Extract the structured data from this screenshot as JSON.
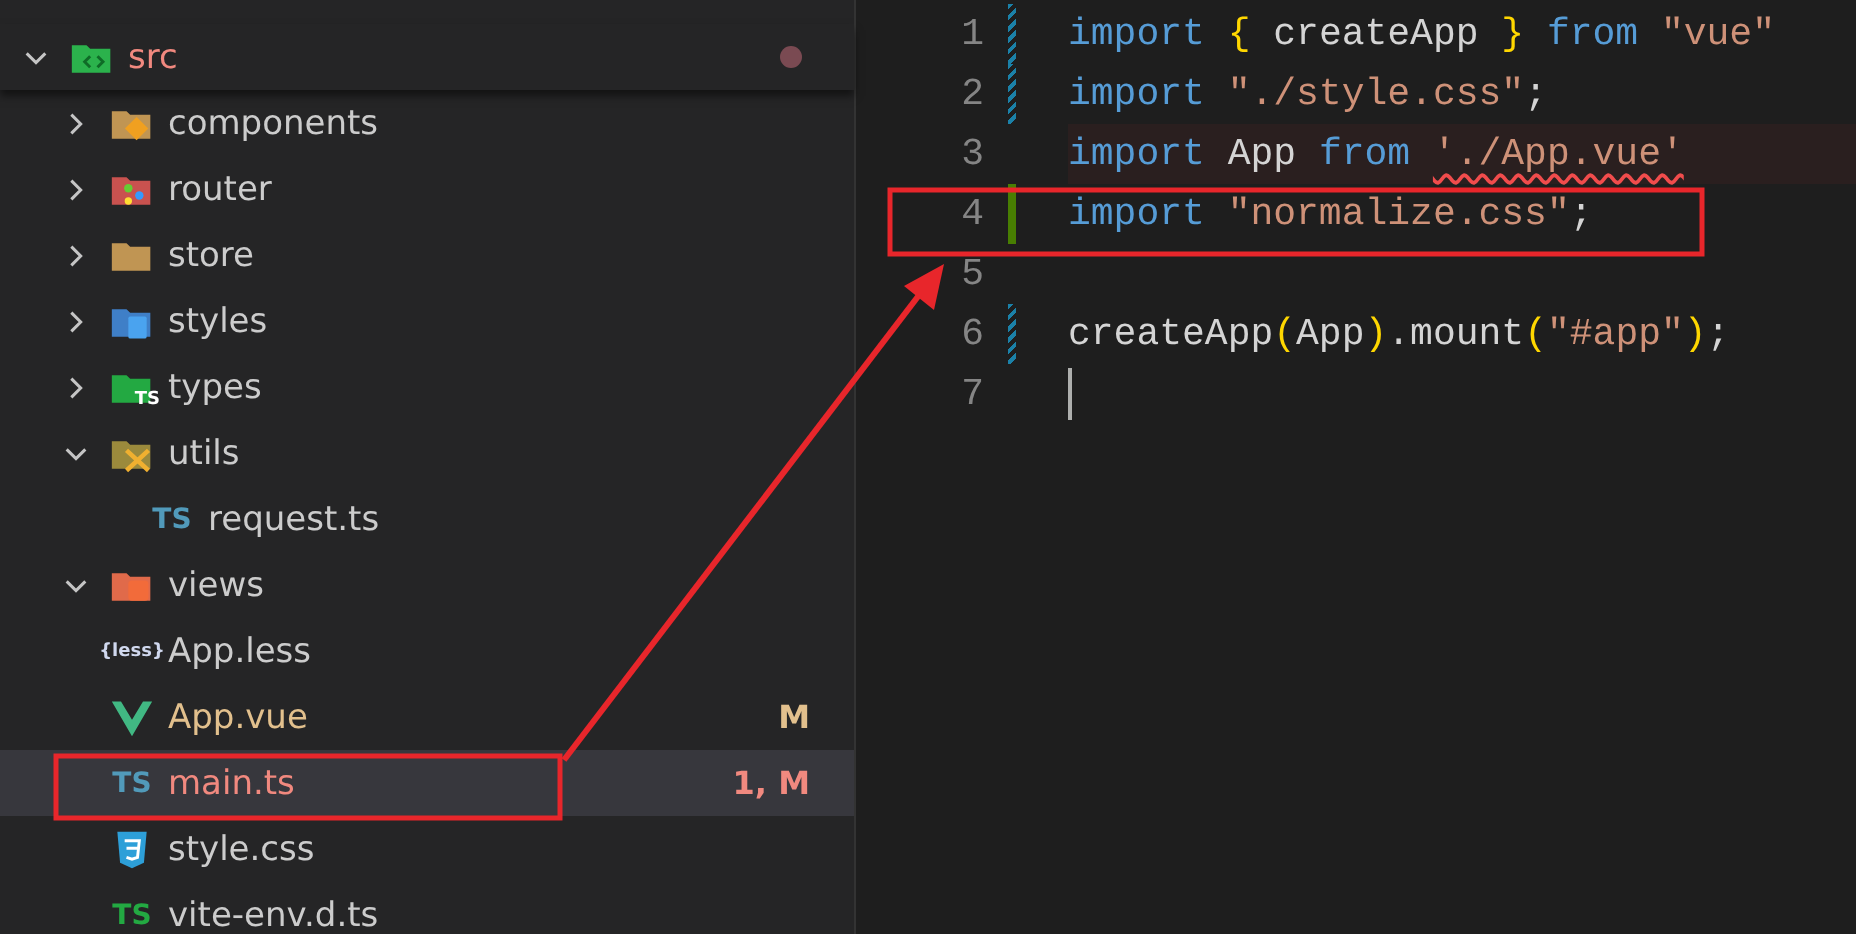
{
  "explorer": {
    "items": [
      {
        "name": "src",
        "kind": "code-folder",
        "expanded": true,
        "has_error": true,
        "problem_dot": true,
        "selected": false,
        "children": [
          {
            "name": "components",
            "kind": "components-folder",
            "expanded": false,
            "selected": false
          },
          {
            "name": "router",
            "kind": "router-folder",
            "expanded": false,
            "selected": false
          },
          {
            "name": "store",
            "kind": "folder",
            "expanded": false,
            "selected": false
          },
          {
            "name": "styles",
            "kind": "styles-folder",
            "expanded": false,
            "selected": false
          },
          {
            "name": "types",
            "kind": "types-folder",
            "icon_label": "TS",
            "expanded": false,
            "selected": false
          },
          {
            "name": "utils",
            "kind": "tools-folder",
            "expanded": true,
            "selected": false,
            "children": [
              {
                "name": "request.ts",
                "kind": "ts-file",
                "icon_label": "TS",
                "selected": false
              }
            ]
          },
          {
            "name": "views",
            "kind": "views-folder",
            "expanded": true,
            "selected": false
          },
          {
            "name": "App.less",
            "kind": "less-file",
            "icon_label": "{less}",
            "selected": false
          },
          {
            "name": "App.vue",
            "kind": "vue-file",
            "modified": true,
            "badge": "M",
            "selected": false
          },
          {
            "name": "main.ts",
            "kind": "ts-file",
            "icon_label": "TS",
            "has_error": true,
            "badge": "1, M",
            "selected": true
          },
          {
            "name": "style.css",
            "kind": "css-file",
            "selected": false
          },
          {
            "name": "vite-env.d.ts",
            "kind": "dts-file",
            "icon_label": "TS",
            "selected": false
          }
        ]
      }
    ]
  },
  "editor": {
    "lines": [
      {
        "number": "1",
        "gutter_changed": true,
        "tokens": [
          {
            "text": "import ",
            "kind": "keyword"
          },
          {
            "text": "{",
            "kind": "bracket"
          },
          {
            "text": " createApp ",
            "kind": "plain"
          },
          {
            "text": "}",
            "kind": "bracket"
          },
          {
            "text": " from",
            "kind": "keyword"
          },
          {
            "text": " \"vue\"",
            "kind": "string"
          }
        ]
      },
      {
        "number": "2",
        "gutter_changed": true,
        "tokens": [
          {
            "text": "import ",
            "kind": "keyword"
          },
          {
            "text": "\"./style.css\"",
            "kind": "string"
          },
          {
            "text": ";",
            "kind": "plain"
          }
        ]
      },
      {
        "number": "3",
        "error": true,
        "tokens": [
          {
            "text": "import",
            "kind": "keyword"
          },
          {
            "text": " App ",
            "kind": "plain"
          },
          {
            "text": "from ",
            "kind": "keyword"
          },
          {
            "text": "'./App.vue'",
            "kind": "string",
            "squiggle": true
          }
        ]
      },
      {
        "number": "4",
        "gutter_added": true,
        "tokens": [
          {
            "text": "import ",
            "kind": "keyword"
          },
          {
            "text": "\"normalize.css\"",
            "kind": "string"
          },
          {
            "text": ";",
            "kind": "plain"
          }
        ]
      },
      {
        "number": "5"
      },
      {
        "number": "6",
        "gutter_changed": true,
        "tokens": [
          {
            "text": "createApp",
            "kind": "plain"
          },
          {
            "text": "(",
            "kind": "bracket"
          },
          {
            "text": "App",
            "kind": "plain"
          },
          {
            "text": ")",
            "kind": "bracket"
          },
          {
            "text": ".mount",
            "kind": "plain"
          },
          {
            "text": "(",
            "kind": "bracket"
          },
          {
            "text": "\"#app\"",
            "kind": "string"
          },
          {
            "text": ")",
            "kind": "bracket"
          },
          {
            "text": ";",
            "kind": "plain"
          }
        ]
      },
      {
        "number": "7",
        "cursor": true
      }
    ]
  }
}
